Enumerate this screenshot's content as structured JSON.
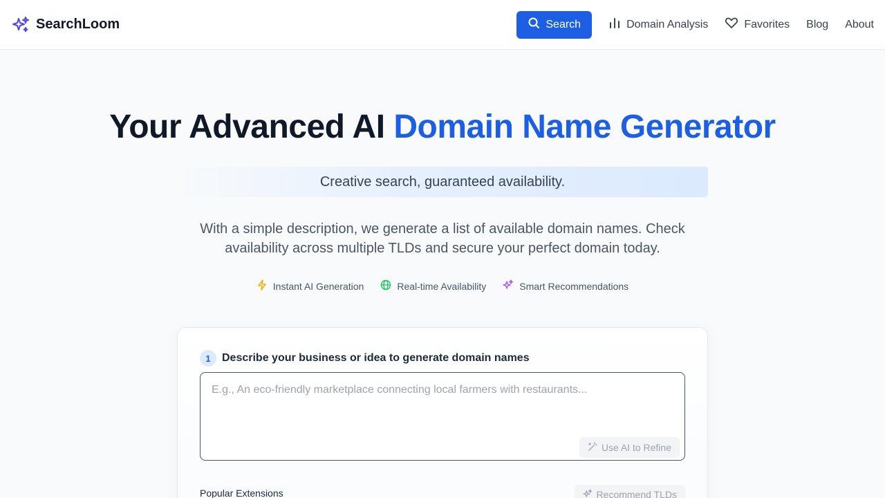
{
  "header": {
    "brand_name": "SearchLoom",
    "nav": {
      "search_label": "Search",
      "domain_analysis_label": "Domain Analysis",
      "favorites_label": "Favorites",
      "blog_label": "Blog",
      "about_label": "About"
    }
  },
  "hero": {
    "title_prefix": "Your Advanced AI ",
    "title_accent": "Domain Name Generator",
    "tagline": "Creative search, guaranteed availability.",
    "description": "With a simple description, we generate a list of available domain names. Check availability across multiple TLDs and secure your perfect domain today.",
    "features": [
      {
        "label": "Instant AI Generation",
        "icon": "lightning-icon",
        "color": "#eab308"
      },
      {
        "label": "Real-time Availability",
        "icon": "globe-icon",
        "color": "#22c55e"
      },
      {
        "label": "Smart Recommendations",
        "icon": "sparkles-icon",
        "color": "#a855f7"
      }
    ]
  },
  "form": {
    "step_number": "1",
    "step_label": "Describe your business or idea to generate domain names",
    "description_placeholder": "E.g., An eco-friendly marketplace connecting local farmers with restaurants...",
    "description_value": "",
    "refine_label": "Use AI to Refine",
    "extensions_label": "Popular Extensions",
    "recommend_label": "Recommend TLDs"
  },
  "colors": {
    "accent": "#1d5fe3",
    "brand_icon": "#4f46e5"
  }
}
